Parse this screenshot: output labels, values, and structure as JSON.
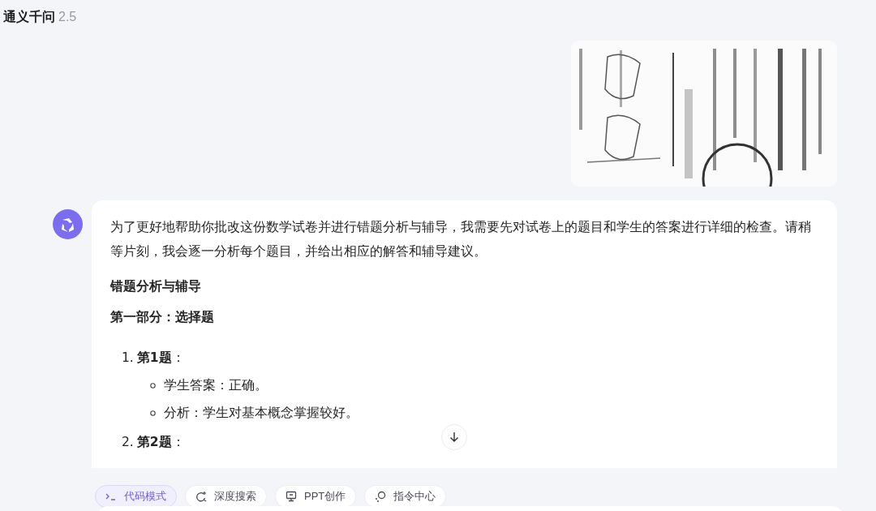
{
  "header": {
    "title": "通义千问",
    "version": "2.5"
  },
  "answer": {
    "paragraph": "为了更好地帮助你批改这份数学试卷并进行错题分析与辅导，我需要先对试卷上的题目和学生的答案进行详细的检查。请稍等片刻，我会逐一分析每个题目，并给出相应的解答和辅导建议。",
    "heading": "错题分析与辅导",
    "section": "第一部分：选择题",
    "items": [
      {
        "number": "1.",
        "title": "**第1题**：",
        "children": [
          "学生答案：正确。",
          "分析：学生对基本概念掌握较好。"
        ]
      },
      {
        "number": "2.",
        "title": "**第2题**："
      }
    ]
  },
  "toolbar": [
    {
      "kind": "code",
      "label": "代码模式",
      "selected": true
    },
    {
      "kind": "search",
      "label": "深度搜索",
      "selected": false
    },
    {
      "kind": "ppt",
      "label": "PPT创作",
      "selected": false
    },
    {
      "kind": "command",
      "label": "指令中心",
      "selected": false
    }
  ]
}
